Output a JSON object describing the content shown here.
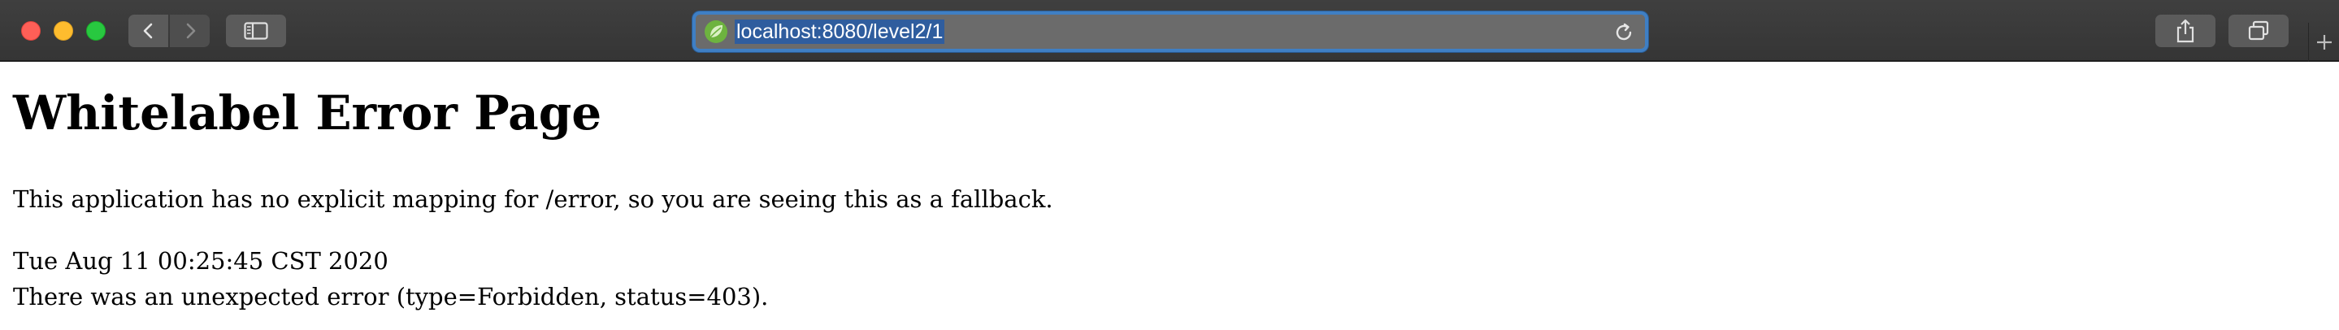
{
  "browser": {
    "url": "localhost:8080/level2/1",
    "buttons": {
      "back": "back",
      "forward": "forward",
      "sidebar": "sidebar",
      "share": "share",
      "tabs": "tabs",
      "new_tab": "new tab"
    },
    "icons": {
      "favicon": "spring-leaf-icon",
      "reload": "reload-icon",
      "share": "share-icon",
      "tabs": "tab-overview-icon",
      "new_tab": "plus-icon"
    },
    "colors": {
      "toolbar": "#3a3a3a",
      "address_focus_ring": "#3f7fc4",
      "url_selection": "#2f5d9e",
      "close": "#fe5f57",
      "minimize": "#febc2e",
      "maximize": "#28c840"
    }
  },
  "page": {
    "title": "Whitelabel Error Page",
    "message": "This application has no explicit mapping for /error, so you are seeing this as a fallback.",
    "timestamp": "Tue Aug 11 00:25:45 CST 2020",
    "error": "There was an unexpected error (type=Forbidden, status=403)."
  }
}
